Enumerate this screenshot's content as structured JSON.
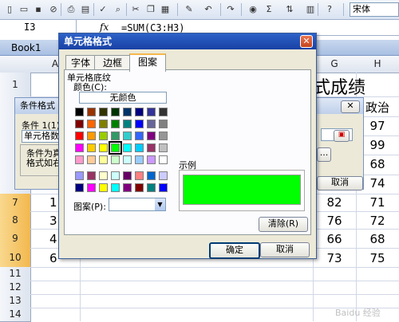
{
  "toolbar": {
    "font_name": "宋体",
    "icons": [
      "new-icon",
      "open-icon",
      "save-icon",
      "permission-icon",
      "print-icon",
      "print-preview-icon",
      "spelling-icon",
      "research-icon",
      "cut-icon",
      "copy-icon",
      "paste-icon",
      "format-painter-icon",
      "undo-icon",
      "redo-icon",
      "hyperlink-icon",
      "autosum-icon",
      "sort-icon",
      "chart-icon",
      "help-icon"
    ],
    "autosum_glyph": "Σ"
  },
  "formula_bar": {
    "cell_ref": "I3",
    "fx": "fx",
    "formula": "=SUM(C3:H3)"
  },
  "workbook": {
    "title": "Book1",
    "columns": [
      "A",
      "G",
      "H"
    ],
    "rows": [
      "1",
      "7",
      "8",
      "9",
      "10",
      "11",
      "12",
      "13",
      "14"
    ],
    "title_fragment": "式成绩",
    "col_header_h": "政治",
    "col_g_values": [
      "82",
      "76",
      "66",
      "73"
    ],
    "col_h_values": [
      "97",
      "99",
      "68",
      "74",
      "71",
      "72",
      "68",
      "75"
    ],
    "col_a_values": [
      "1",
      "3",
      "4",
      "6"
    ]
  },
  "cf_dialog": {
    "title": "条件格式",
    "condition_label": "条件 1(1)",
    "condition_value": "单元格数",
    "preview_text_1": "条件为真",
    "preview_text_2": "格式如右",
    "cancel_label": "取消",
    "dots_label": "..."
  },
  "format_dialog": {
    "title": "单元格格式",
    "tabs": [
      "字体",
      "边框",
      "图案"
    ],
    "active_tab": "图案",
    "shading_label": "单元格底纹",
    "color_label": "颜色(C):",
    "no_color": "无颜色",
    "sample_label": "示例",
    "pattern_label": "图案(P):",
    "clear_label": "清除(R)",
    "ok_label": "确定",
    "cancel_label": "取消",
    "sample_color": "#00ff00",
    "selected_color": "#00ff00",
    "palette_rows": [
      [
        "#000000",
        "#993300",
        "#333300",
        "#003300",
        "#003366",
        "#000080",
        "#333399",
        "#333333"
      ],
      [
        "#800000",
        "#ff6600",
        "#808000",
        "#008000",
        "#008080",
        "#0000ff",
        "#666699",
        "#808080"
      ],
      [
        "#ff0000",
        "#ff9900",
        "#99cc00",
        "#339966",
        "#33cccc",
        "#3366ff",
        "#800080",
        "#969696"
      ],
      [
        "#ff00ff",
        "#ffcc00",
        "#ffff00",
        "#00ff00",
        "#00ffff",
        "#00ccff",
        "#993366",
        "#c0c0c0"
      ],
      [
        "#ff99cc",
        "#ffcc99",
        "#ffff99",
        "#ccffcc",
        "#ccffff",
        "#99ccff",
        "#cc99ff",
        "#ffffff"
      ]
    ],
    "palette_rows_2": [
      [
        "#9999ff",
        "#993366",
        "#ffffcc",
        "#ccffff",
        "#660066",
        "#ff8080",
        "#0066cc",
        "#ccccff"
      ],
      [
        "#000080",
        "#ff00ff",
        "#ffff00",
        "#00ffff",
        "#800080",
        "#800000",
        "#008080",
        "#0000ff"
      ]
    ]
  },
  "watermark": "Baidu 经验"
}
